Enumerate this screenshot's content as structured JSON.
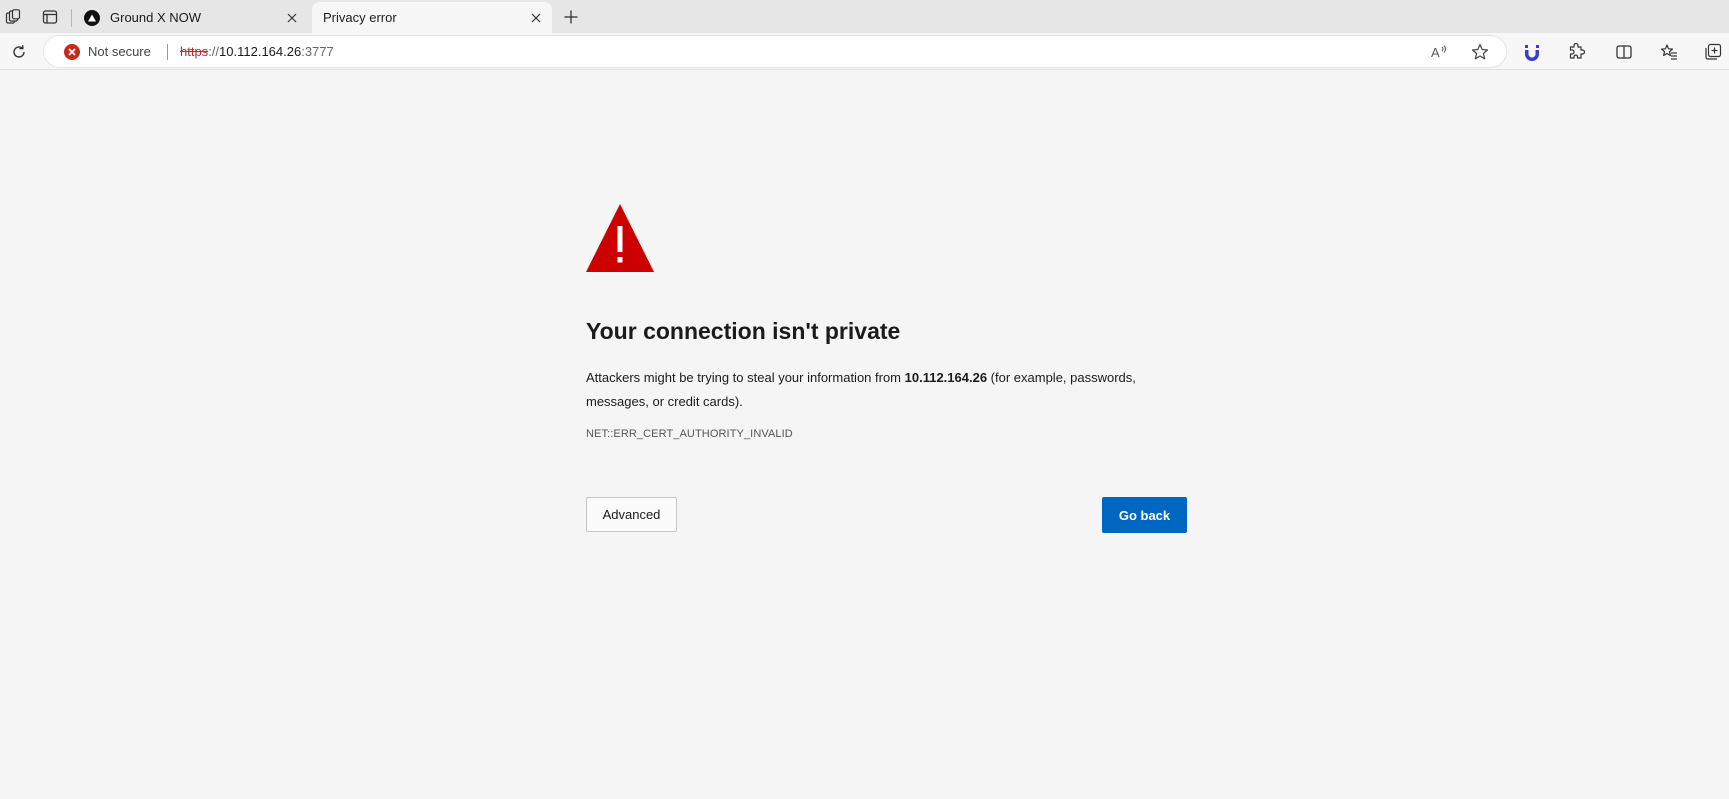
{
  "tabs": [
    {
      "label": "Ground X NOW",
      "icon": "ground-x-favicon",
      "active": false
    },
    {
      "label": "Privacy error",
      "icon": "none",
      "active": true
    }
  ],
  "address_bar": {
    "security_label": "Not secure",
    "url_scheme": "https",
    "url_separator": "://",
    "url_host": "10.112.164.26",
    "url_port": ":3777"
  },
  "toolbar_icons": [
    "refresh-icon",
    "read-aloud-icon",
    "favorite-star-icon",
    "extension-u-icon",
    "extensions-icon",
    "split-screen-icon",
    "favorites-icon",
    "collections-icon"
  ],
  "error_page": {
    "title": "Your connection isn't private",
    "body_prefix": "Attackers might be trying to steal your information from ",
    "body_host": "10.112.164.26",
    "body_suffix": " (for example, passwords, messages, or credit cards).",
    "error_code": "NET::ERR_CERT_AUTHORITY_INVALID",
    "advanced_label": "Advanced",
    "go_back_label": "Go back"
  },
  "colors": {
    "warning_red": "#cc0000",
    "primary_button": "#0067c0",
    "not_secure_red": "#c42b1c",
    "extension_accent": "#3c3ccc"
  }
}
